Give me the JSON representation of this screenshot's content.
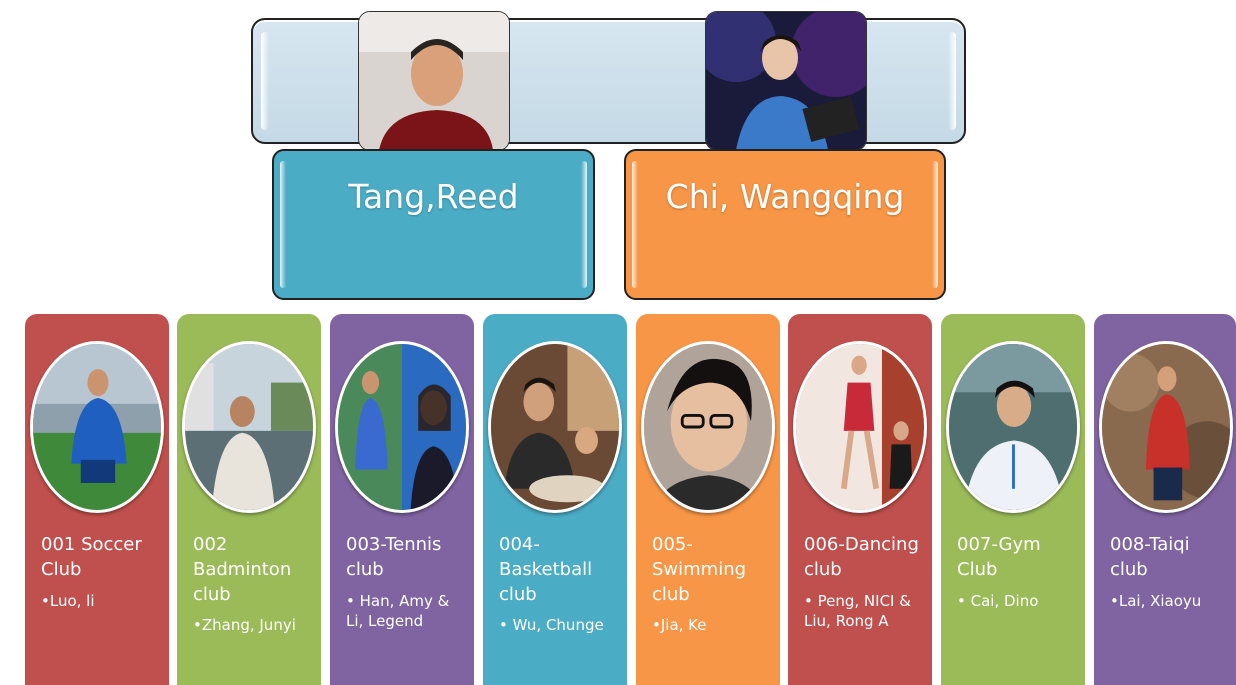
{
  "colors": {
    "banner": "#cfe0ea",
    "leader_left": "#4bacc6",
    "leader_right": "#f79646",
    "red": "#c0504d",
    "green": "#9bbb59",
    "purple": "#8064a2",
    "teal": "#4bacc6",
    "orange": "#f79646"
  },
  "leaders": [
    {
      "name": "Tang,Reed"
    },
    {
      "name": "Chi, Wangqing"
    }
  ],
  "clubs": [
    {
      "title": "001 Soccer Club",
      "member": "•Luo, li",
      "color": "#c0504d"
    },
    {
      "title": "002 Badminton club",
      "member": "•Zhang, Junyi",
      "color": "#9bbb59"
    },
    {
      "title": "003-Tennis club",
      "member": "• Han, Amy & Li, Legend",
      "color": "#8064a2"
    },
    {
      "title": "004-Basketball club",
      "member": "• Wu, Chunge",
      "color": "#4bacc6"
    },
    {
      "title": "005-Swimming club",
      "member": "•Jia, Ke",
      "color": "#f79646"
    },
    {
      "title": "006-Dancing club",
      "member": "• Peng, NICI & Liu, Rong A",
      "color": "#c0504d"
    },
    {
      "title": "007-Gym Club",
      "member": "• Cai, Dino",
      "color": "#9bbb59"
    },
    {
      "title": "008-Taiqi club",
      "member": "•Lai, Xiaoyu",
      "color": "#8064a2"
    }
  ]
}
